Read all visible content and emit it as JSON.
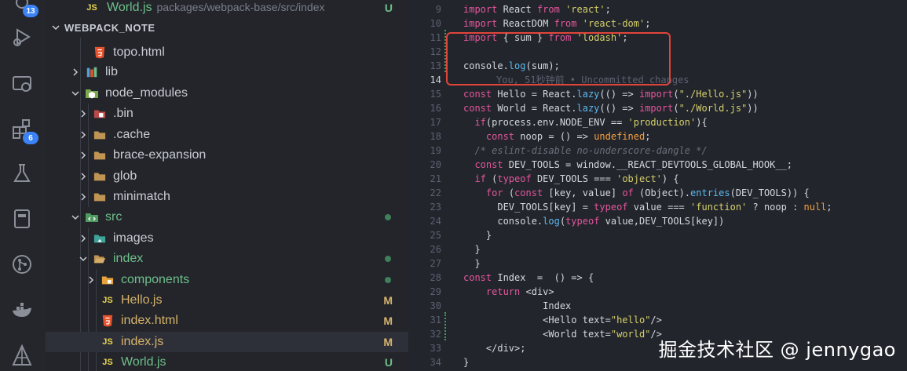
{
  "activity_bar": {
    "top_badge": "13",
    "extensions_badge": "6",
    "icons": [
      "source-control-icon",
      "run-debug-icon",
      "remote-explorer-icon",
      "extensions-icon",
      "testing-icon",
      "bookmarks-icon",
      "git-graph-icon",
      "docker-icon",
      "deploy-icon"
    ]
  },
  "explorer": {
    "top_row": {
      "icon": "JS",
      "label": "World.js",
      "description": "packages/webpack-base/src/index",
      "status": "U"
    },
    "section_title": "WEBPACK_NOTE",
    "items": [
      {
        "label": "topo.html",
        "type": "html"
      },
      {
        "label": "lib",
        "type": "folder",
        "expanded": false
      },
      {
        "label": "node_modules",
        "type": "folder-node",
        "expanded": true
      },
      {
        "label": ".bin",
        "type": "folder-bin",
        "expanded": false
      },
      {
        "label": ".cache",
        "type": "folder",
        "expanded": false
      },
      {
        "label": "brace-expansion",
        "type": "folder",
        "expanded": false
      },
      {
        "label": "glob",
        "type": "folder",
        "expanded": false
      },
      {
        "label": "minimatch",
        "type": "folder",
        "expanded": false
      },
      {
        "label": "src",
        "type": "folder-src",
        "expanded": true,
        "status": "dot"
      },
      {
        "label": "images",
        "type": "folder-images",
        "expanded": false
      },
      {
        "label": "index",
        "type": "folder",
        "expanded": true,
        "status": "dot"
      },
      {
        "label": "components",
        "type": "folder-components",
        "expanded": false,
        "status": "dot"
      },
      {
        "label": "Hello.js",
        "type": "js",
        "status": "M"
      },
      {
        "label": "index.html",
        "type": "html",
        "status": "M"
      },
      {
        "label": "index.js",
        "type": "js",
        "status": "M",
        "selected": true
      },
      {
        "label": "World.js",
        "type": "js",
        "status": "U"
      }
    ]
  },
  "editor": {
    "current_line": 14,
    "blame": "You, 51秒钟前 • Uncommitted changes",
    "lines": [
      {
        "n": 9,
        "code": "import React from 'react';"
      },
      {
        "n": 10,
        "code": "import ReactDOM from 'react-dom';"
      },
      {
        "n": 11,
        "code": "import { sum } from 'lodash';"
      },
      {
        "n": 12,
        "code": ""
      },
      {
        "n": 13,
        "code": "console.log(sum);"
      },
      {
        "n": 14,
        "code": ""
      },
      {
        "n": 15,
        "code": "const Hello = React.lazy(() => import(\"./Hello.js\"))"
      },
      {
        "n": 16,
        "code": "const World = React.lazy(() => import(\"./World.js\"))"
      },
      {
        "n": 17,
        "code": "  if(process.env.NODE_ENV == 'production'){"
      },
      {
        "n": 18,
        "code": "    const noop = () => undefined;"
      },
      {
        "n": 19,
        "code": "  /* eslint-disable no-underscore-dangle */"
      },
      {
        "n": 20,
        "code": "  const DEV_TOOLS = window.__REACT_DEVTOOLS_GLOBAL_HOOK__;"
      },
      {
        "n": 21,
        "code": "  if (typeof DEV_TOOLS === 'object') {"
      },
      {
        "n": 22,
        "code": "    for (const [key, value] of (Object).entries(DEV_TOOLS)) {"
      },
      {
        "n": 23,
        "code": "      DEV_TOOLS[key] = typeof value === 'function' ? noop : null;"
      },
      {
        "n": 24,
        "code": "      console.log(typeof value,DEV_TOOLS[key])"
      },
      {
        "n": 25,
        "code": "    }"
      },
      {
        "n": 26,
        "code": "  }"
      },
      {
        "n": 27,
        "code": "  }"
      },
      {
        "n": 28,
        "code": "const Index  =  () => {"
      },
      {
        "n": 29,
        "code": "    return <div>"
      },
      {
        "n": 30,
        "code": "              Index"
      },
      {
        "n": 31,
        "code": "              <Hello text=\"hello\"/>"
      },
      {
        "n": 32,
        "code": "              <World text=\"world\"/>"
      },
      {
        "n": 33,
        "code": "    </div>;"
      },
      {
        "n": 34,
        "code": "}"
      }
    ]
  },
  "watermark": "掘金技术社区 @ jennygao",
  "colors": {
    "highlight_box": "#e0453a",
    "modified": "#d6b36b",
    "untracked": "#6fbf8a",
    "js_icon": "#e8d44d",
    "html_icon": "#e6522c",
    "folder": "#c09553"
  }
}
